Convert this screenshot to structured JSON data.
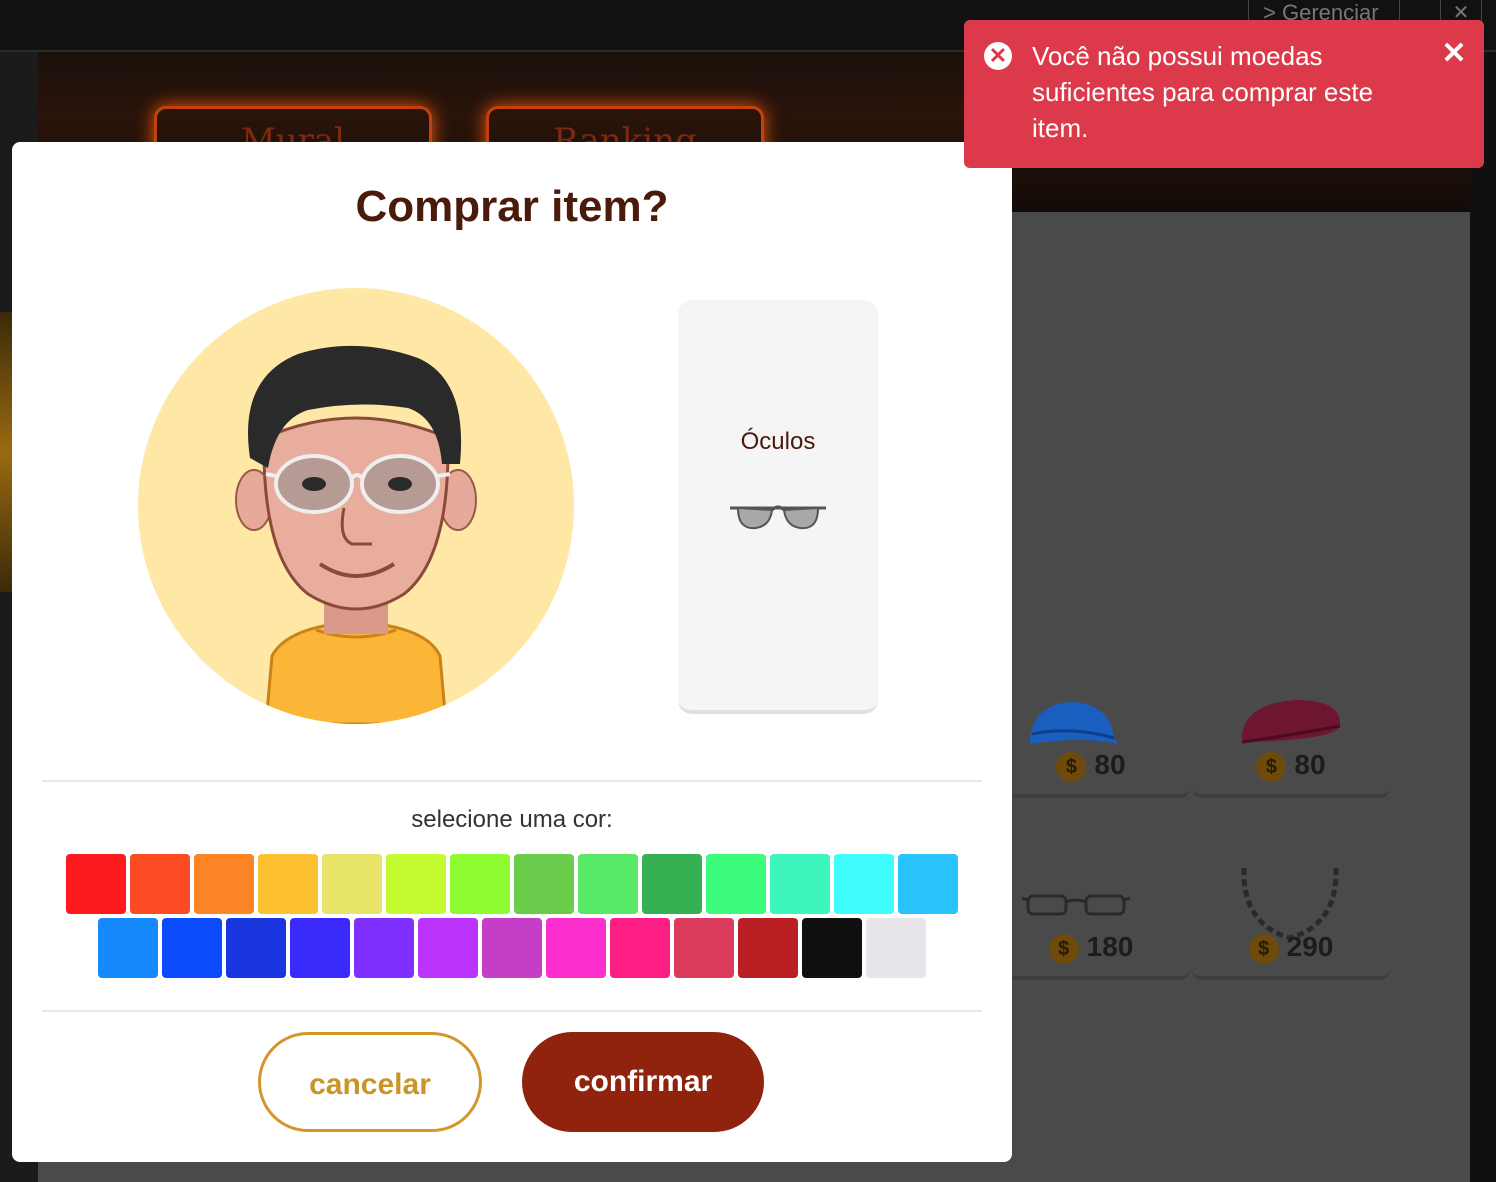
{
  "background": {
    "manage_label": "Gerenciar",
    "close_label": "✕",
    "banner_buttons": [
      "Mural",
      "Ranking"
    ],
    "shop_items": [
      {
        "name": "blue-cap",
        "price": "80"
      },
      {
        "name": "beret",
        "price": "80"
      },
      {
        "name": "glasses",
        "price": "180"
      },
      {
        "name": "chain-necklace",
        "price": "290"
      }
    ],
    "coin_symbol": "$"
  },
  "modal": {
    "title": "Comprar item?",
    "item_name": "Óculos",
    "color_label": "selecione uma cor:",
    "cancel_label": "cancelar",
    "confirm_label": "confirmar",
    "colors_row1": [
      "#fc1a1f",
      "#fc4a22",
      "#fc8424",
      "#fcc030",
      "#e8e46a",
      "#c4fa30",
      "#8cfc30",
      "#6acc4a",
      "#58ea66",
      "#36b052",
      "#3cfc7c",
      "#3cf6be",
      "#3efcfc",
      "#2ac2fc"
    ],
    "colors_row2": [
      "#168afc",
      "#0a4cfc",
      "#1a36de",
      "#3a2afc",
      "#7e30fc",
      "#bc34fc",
      "#c63ec8",
      "#fc2ece",
      "#fc1e82",
      "#dc3c5c",
      "#ba1f24",
      "#101010",
      "#e8e6ec"
    ]
  },
  "toast": {
    "message": "Você não possui moedas suficientes para comprar este item.",
    "icon": "error-icon",
    "close": "✕"
  }
}
